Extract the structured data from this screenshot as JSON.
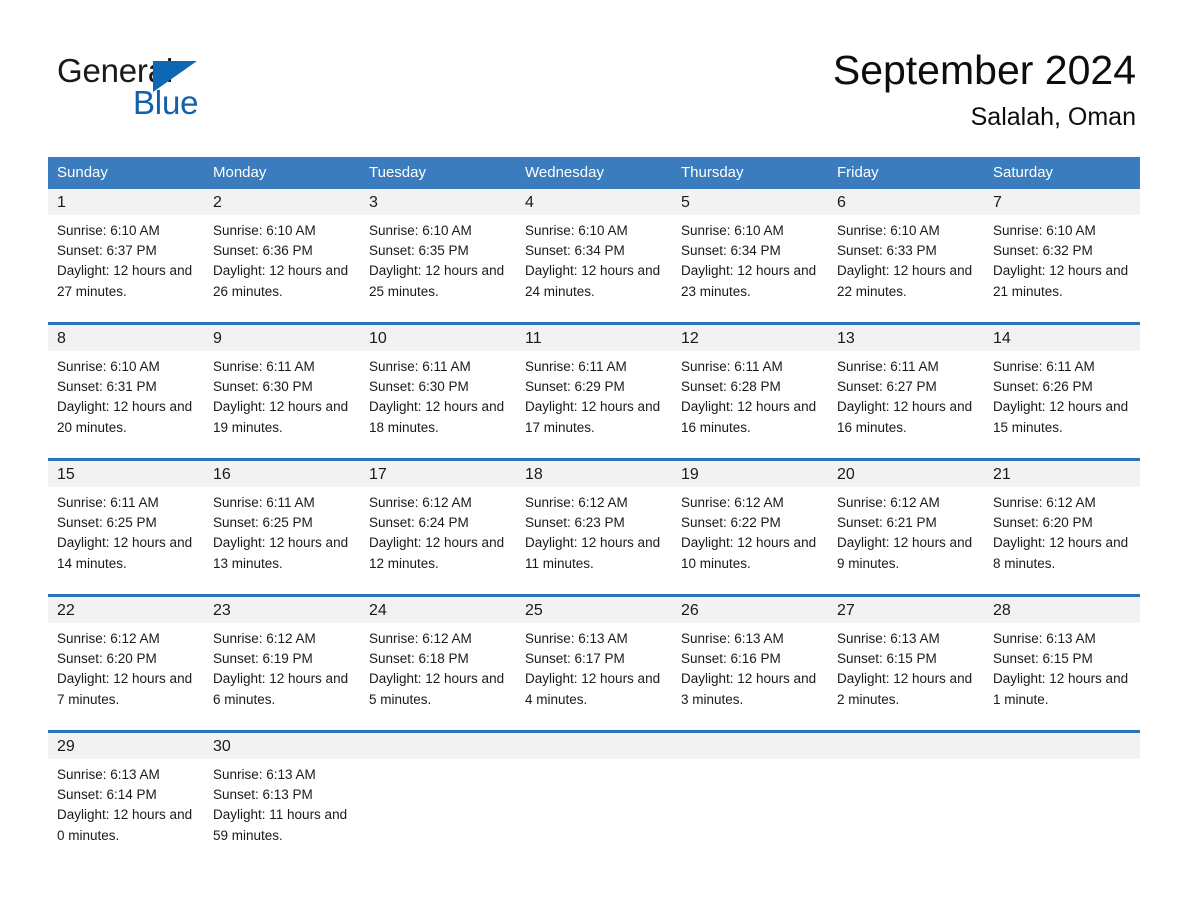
{
  "brand": {
    "name_part1": "General",
    "name_part2": "Blue",
    "accent_color": "#1060ab",
    "triangle_color": "#0c68b4"
  },
  "header": {
    "title": "September 2024",
    "location": "Salalah, Oman"
  },
  "calendar": {
    "header_color": "#3a7cbe",
    "row_divider_color": "#2f73b7",
    "day_band_color": "#f2f2f2",
    "weekdays": [
      "Sunday",
      "Monday",
      "Tuesday",
      "Wednesday",
      "Thursday",
      "Friday",
      "Saturday"
    ],
    "weeks": [
      [
        {
          "day": "1",
          "sunrise": "Sunrise: 6:10 AM",
          "sunset": "Sunset: 6:37 PM",
          "daylight": "Daylight: 12 hours and 27 minutes."
        },
        {
          "day": "2",
          "sunrise": "Sunrise: 6:10 AM",
          "sunset": "Sunset: 6:36 PM",
          "daylight": "Daylight: 12 hours and 26 minutes."
        },
        {
          "day": "3",
          "sunrise": "Sunrise: 6:10 AM",
          "sunset": "Sunset: 6:35 PM",
          "daylight": "Daylight: 12 hours and 25 minutes."
        },
        {
          "day": "4",
          "sunrise": "Sunrise: 6:10 AM",
          "sunset": "Sunset: 6:34 PM",
          "daylight": "Daylight: 12 hours and 24 minutes."
        },
        {
          "day": "5",
          "sunrise": "Sunrise: 6:10 AM",
          "sunset": "Sunset: 6:34 PM",
          "daylight": "Daylight: 12 hours and 23 minutes."
        },
        {
          "day": "6",
          "sunrise": "Sunrise: 6:10 AM",
          "sunset": "Sunset: 6:33 PM",
          "daylight": "Daylight: 12 hours and 22 minutes."
        },
        {
          "day": "7",
          "sunrise": "Sunrise: 6:10 AM",
          "sunset": "Sunset: 6:32 PM",
          "daylight": "Daylight: 12 hours and 21 minutes."
        }
      ],
      [
        {
          "day": "8",
          "sunrise": "Sunrise: 6:10 AM",
          "sunset": "Sunset: 6:31 PM",
          "daylight": "Daylight: 12 hours and 20 minutes."
        },
        {
          "day": "9",
          "sunrise": "Sunrise: 6:11 AM",
          "sunset": "Sunset: 6:30 PM",
          "daylight": "Daylight: 12 hours and 19 minutes."
        },
        {
          "day": "10",
          "sunrise": "Sunrise: 6:11 AM",
          "sunset": "Sunset: 6:30 PM",
          "daylight": "Daylight: 12 hours and 18 minutes."
        },
        {
          "day": "11",
          "sunrise": "Sunrise: 6:11 AM",
          "sunset": "Sunset: 6:29 PM",
          "daylight": "Daylight: 12 hours and 17 minutes."
        },
        {
          "day": "12",
          "sunrise": "Sunrise: 6:11 AM",
          "sunset": "Sunset: 6:28 PM",
          "daylight": "Daylight: 12 hours and 16 minutes."
        },
        {
          "day": "13",
          "sunrise": "Sunrise: 6:11 AM",
          "sunset": "Sunset: 6:27 PM",
          "daylight": "Daylight: 12 hours and 16 minutes."
        },
        {
          "day": "14",
          "sunrise": "Sunrise: 6:11 AM",
          "sunset": "Sunset: 6:26 PM",
          "daylight": "Daylight: 12 hours and 15 minutes."
        }
      ],
      [
        {
          "day": "15",
          "sunrise": "Sunrise: 6:11 AM",
          "sunset": "Sunset: 6:25 PM",
          "daylight": "Daylight: 12 hours and 14 minutes."
        },
        {
          "day": "16",
          "sunrise": "Sunrise: 6:11 AM",
          "sunset": "Sunset: 6:25 PM",
          "daylight": "Daylight: 12 hours and 13 minutes."
        },
        {
          "day": "17",
          "sunrise": "Sunrise: 6:12 AM",
          "sunset": "Sunset: 6:24 PM",
          "daylight": "Daylight: 12 hours and 12 minutes."
        },
        {
          "day": "18",
          "sunrise": "Sunrise: 6:12 AM",
          "sunset": "Sunset: 6:23 PM",
          "daylight": "Daylight: 12 hours and 11 minutes."
        },
        {
          "day": "19",
          "sunrise": "Sunrise: 6:12 AM",
          "sunset": "Sunset: 6:22 PM",
          "daylight": "Daylight: 12 hours and 10 minutes."
        },
        {
          "day": "20",
          "sunrise": "Sunrise: 6:12 AM",
          "sunset": "Sunset: 6:21 PM",
          "daylight": "Daylight: 12 hours and 9 minutes."
        },
        {
          "day": "21",
          "sunrise": "Sunrise: 6:12 AM",
          "sunset": "Sunset: 6:20 PM",
          "daylight": "Daylight: 12 hours and 8 minutes."
        }
      ],
      [
        {
          "day": "22",
          "sunrise": "Sunrise: 6:12 AM",
          "sunset": "Sunset: 6:20 PM",
          "daylight": "Daylight: 12 hours and 7 minutes."
        },
        {
          "day": "23",
          "sunrise": "Sunrise: 6:12 AM",
          "sunset": "Sunset: 6:19 PM",
          "daylight": "Daylight: 12 hours and 6 minutes."
        },
        {
          "day": "24",
          "sunrise": "Sunrise: 6:12 AM",
          "sunset": "Sunset: 6:18 PM",
          "daylight": "Daylight: 12 hours and 5 minutes."
        },
        {
          "day": "25",
          "sunrise": "Sunrise: 6:13 AM",
          "sunset": "Sunset: 6:17 PM",
          "daylight": "Daylight: 12 hours and 4 minutes."
        },
        {
          "day": "26",
          "sunrise": "Sunrise: 6:13 AM",
          "sunset": "Sunset: 6:16 PM",
          "daylight": "Daylight: 12 hours and 3 minutes."
        },
        {
          "day": "27",
          "sunrise": "Sunrise: 6:13 AM",
          "sunset": "Sunset: 6:15 PM",
          "daylight": "Daylight: 12 hours and 2 minutes."
        },
        {
          "day": "28",
          "sunrise": "Sunrise: 6:13 AM",
          "sunset": "Sunset: 6:15 PM",
          "daylight": "Daylight: 12 hours and 1 minute."
        }
      ],
      [
        {
          "day": "29",
          "sunrise": "Sunrise: 6:13 AM",
          "sunset": "Sunset: 6:14 PM",
          "daylight": "Daylight: 12 hours and 0 minutes."
        },
        {
          "day": "30",
          "sunrise": "Sunrise: 6:13 AM",
          "sunset": "Sunset: 6:13 PM",
          "daylight": "Daylight: 11 hours and 59 minutes."
        },
        {
          "day": "",
          "sunrise": "",
          "sunset": "",
          "daylight": ""
        },
        {
          "day": "",
          "sunrise": "",
          "sunset": "",
          "daylight": ""
        },
        {
          "day": "",
          "sunrise": "",
          "sunset": "",
          "daylight": ""
        },
        {
          "day": "",
          "sunrise": "",
          "sunset": "",
          "daylight": ""
        },
        {
          "day": "",
          "sunrise": "",
          "sunset": "",
          "daylight": ""
        }
      ]
    ]
  }
}
